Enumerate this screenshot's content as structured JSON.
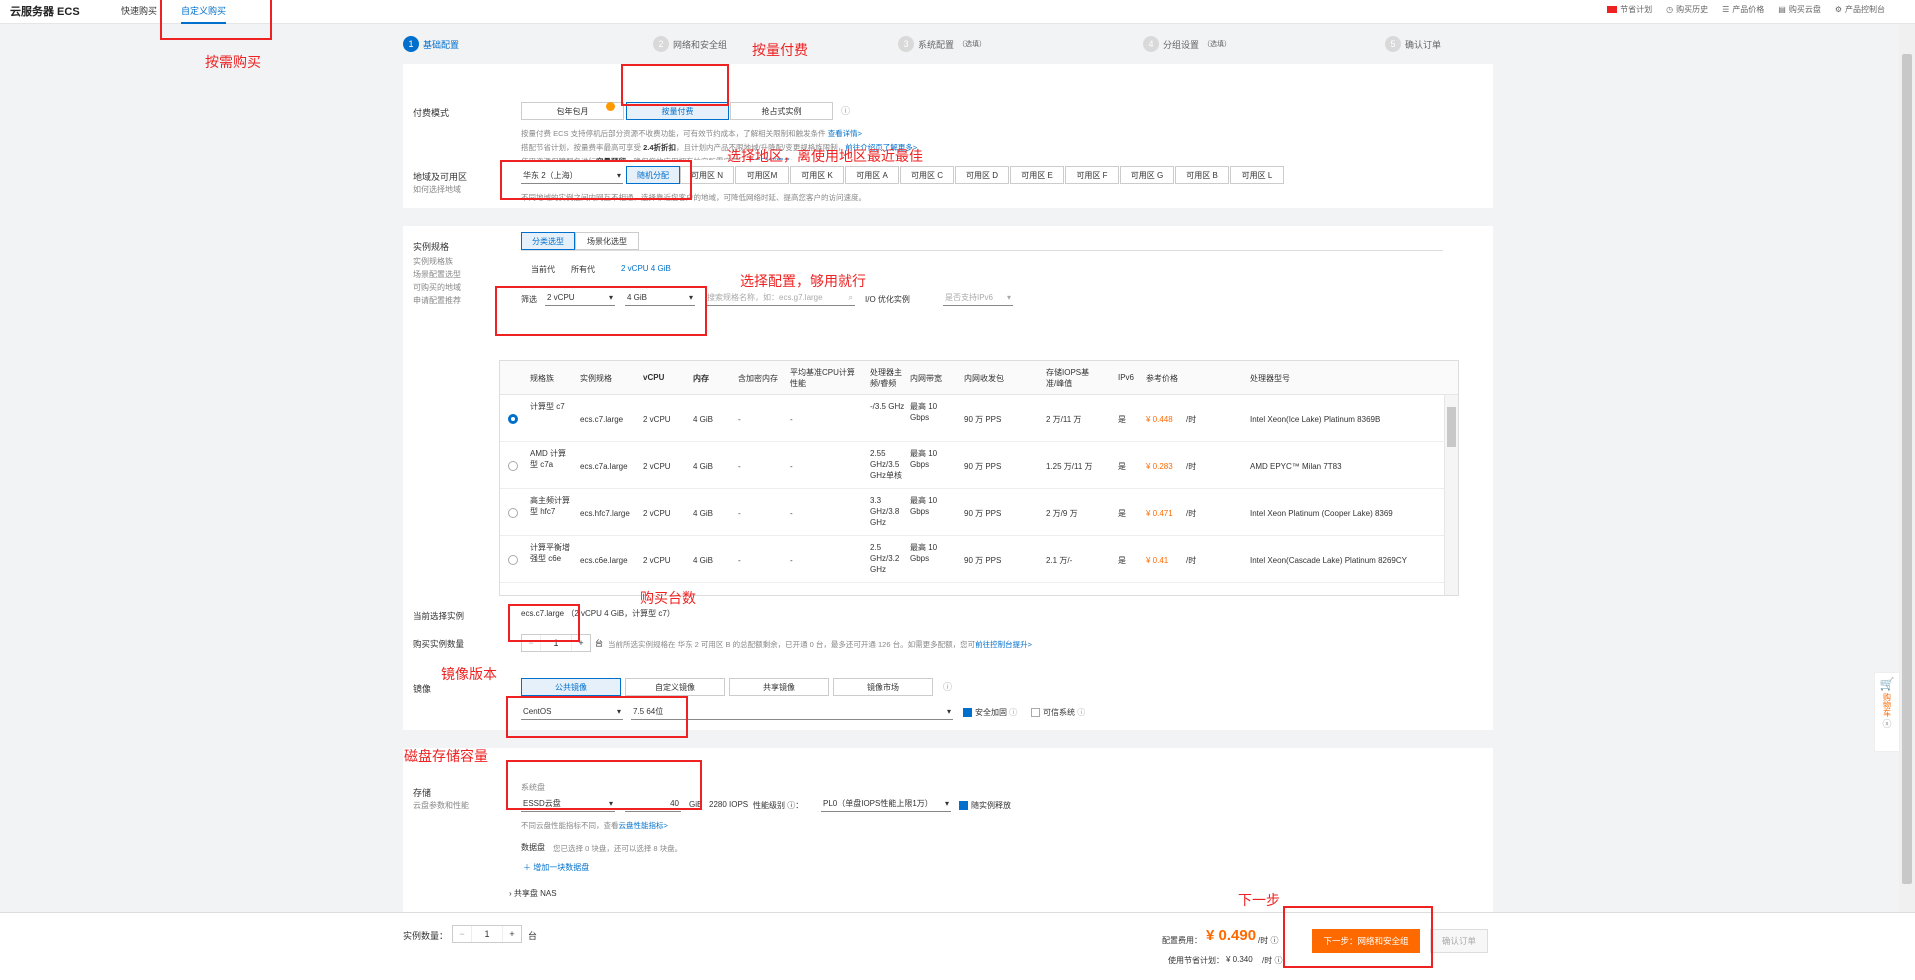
{
  "topbar": {
    "brand": "云服务器 ECS",
    "tabs": [
      "快速购买",
      "自定义购买"
    ],
    "links": [
      "节省计划",
      "购买历史",
      "产品价格",
      "购买云盘",
      "产品控制台"
    ]
  },
  "steps": [
    {
      "num": "1",
      "label": "基础配置",
      "opt": ""
    },
    {
      "num": "2",
      "label": "网络和安全组",
      "opt": ""
    },
    {
      "num": "3",
      "label": "系统配置",
      "opt": "（选填）"
    },
    {
      "num": "4",
      "label": "分组设置",
      "opt": "（选填）"
    },
    {
      "num": "5",
      "label": "确认订单",
      "opt": ""
    }
  ],
  "billing": {
    "label": "付费模式",
    "options": [
      "包年包月",
      "按量付费",
      "抢占式实例"
    ],
    "notes": [
      "按量付费 ECS 支持停机后部分资源不收费功能，可有效节约成本，了解相关限制和触发条件",
      "查看详情>",
      "搭配节省计划，按量费率最高可享受",
      "2.4折折扣",
      "，且计划内产品不限地域/升降配/变更规格族限制，",
      "前往介绍页了解更多>",
      "使用资源保障服务进行",
      "容量预留",
      "，确保您的应用拥有扩容所需容量，",
      "点击了解更多>"
    ]
  },
  "region": {
    "label": "地域及可用区",
    "help": "如何选择地域",
    "selected": "华东 2（上海）",
    "zones": [
      "随机分配",
      "可用区 N",
      "可用区M",
      "可用区 K",
      "可用区 A",
      "可用区 C",
      "可用区 D",
      "可用区 E",
      "可用区 F",
      "可用区 G",
      "可用区 B",
      "可用区 L"
    ],
    "note": "不同地域的实例之间内网互不相通，选择靠近您客户的地域，可降低网络时延、提高您客户的访问速度。"
  },
  "instance": {
    "label": "实例规格",
    "side_links": [
      "实例规格族",
      "场景配置选型",
      "可购买的地域",
      "申请配置推荐"
    ],
    "tabs": [
      "分类选型",
      "场景化选型"
    ],
    "gens": [
      "当前代",
      "所有代",
      "2 vCPU 4 GiB"
    ],
    "filter_label": "筛选",
    "cpu": "2 vCPU",
    "mem": "4 GiB",
    "search_placeholder": "搜索规格名称，如：ecs.g7.large",
    "io_label": "I/O 优化实例",
    "ipv6": "是否支持IPv6",
    "headers": [
      "规格族",
      "实例规格",
      "vCPU",
      "内存",
      "含加密内存",
      "平均基准CPU计算性能",
      "处理器主频/睿频",
      "内网带宽",
      "内网收发包",
      "存储IOPS基准/峰值",
      "IPv6",
      "参考价格",
      "处理器型号"
    ],
    "rows": [
      {
        "family": "计算型 c7",
        "spec": "ecs.c7.large",
        "vcpu": "2 vCPU",
        "mem": "4 GiB",
        "enc": "-",
        "base": "-",
        "freq": "-/3.5 GHz",
        "bw": "最高 10 Gbps",
        "pps": "90 万 PPS",
        "iops": "2 万/11 万",
        "ipv6": "是",
        "price": "¥ 0.448",
        "unit": "/时",
        "cpu_model": "Intel Xeon(Ice Lake) Platinum 8369B"
      },
      {
        "family": "AMD 计算型 c7a",
        "spec": "ecs.c7a.large",
        "vcpu": "2 vCPU",
        "mem": "4 GiB",
        "enc": "-",
        "base": "-",
        "freq": "2.55 GHz/3.5 GHz单核",
        "bw": "最高 10 Gbps",
        "pps": "90 万 PPS",
        "iops": "1.25 万/11 万",
        "ipv6": "是",
        "price": "¥ 0.283",
        "unit": "/时",
        "cpu_model": "AMD EPYC™ Milan 7T83"
      },
      {
        "family": "高主频计算型 hfc7",
        "spec": "ecs.hfc7.large",
        "vcpu": "2 vCPU",
        "mem": "4 GiB",
        "enc": "-",
        "base": "-",
        "freq": "3.3 GHz/3.8 GHz",
        "bw": "最高 10 Gbps",
        "pps": "90 万 PPS",
        "iops": "2 万/9 万",
        "ipv6": "是",
        "price": "¥ 0.471",
        "unit": "/时",
        "cpu_model": "Intel Xeon Platinum (Cooper Lake) 8369"
      },
      {
        "family": "计算平衡增强型 c6e",
        "spec": "ecs.c6e.large",
        "vcpu": "2 vCPU",
        "mem": "4 GiB",
        "enc": "-",
        "base": "-",
        "freq": "2.5 GHz/3.2 GHz",
        "bw": "最高 10 Gbps",
        "pps": "90 万 PPS",
        "iops": "2.1 万/-",
        "ipv6": "是",
        "price": "¥ 0.41",
        "unit": "/时",
        "cpu_model": "Intel Xeon(Cascade Lake) Platinum 8269CY"
      }
    ]
  },
  "current": {
    "label": "当前选择实例",
    "value": "ecs.c7.large （2 vCPU 4 GiB，计算型 c7）"
  },
  "quantity": {
    "label": "购买实例数量",
    "value": "1",
    "unit": "台",
    "note": "当前所选实例规格在 华东 2 可用区 B 的总配额剩余，已开通 0 台，最多还可开通 126 台。如需更多配额，您可",
    "link": "前往控制台提升>"
  },
  "image": {
    "label": "镜像",
    "tabs": [
      "公共镜像",
      "自定义镜像",
      "共享镜像",
      "镜像市场"
    ],
    "os": "CentOS",
    "version": "7.5 64位",
    "secure": "安全加固",
    "trusted": "可信系统"
  },
  "storage": {
    "label": "存储",
    "sub": "云盘参数和性能",
    "sys_label": "系统盘",
    "disk_type": "ESSD云盘",
    "size": "40",
    "unit": "GiB",
    "iops": "2280 IOPS",
    "perf_label": "性能级别",
    "perf": "PL0（单盘IOPS性能上限1万）",
    "release": "随实例释放",
    "hint": "不同云盘性能指标不同，查看",
    "hint_link": "云盘性能指标>",
    "data_label": "数据盘",
    "data_note": "您已选择 0 块盘，还可以选择 8 块盘。",
    "add_data": "增加一块数据盘",
    "nas": "共享盘 NAS"
  },
  "footer": {
    "qty_label": "实例数量：",
    "qty": "1",
    "qty_unit": "台",
    "fee_label": "配置费用：",
    "fee": "¥ 0.490",
    "fee_unit": "/时",
    "plan_label": "使用节省计划：",
    "plan": "¥ 0.340",
    "plan_unit": "/时",
    "next": "下一步：网络和安全组",
    "confirm": "确认订单"
  },
  "cart": {
    "label": "购物车"
  },
  "annotations": {
    "a1": "按需购买",
    "a2": "按量付费",
    "a3": "选择地区，离使用地区最近最佳",
    "a4": "选择配置，够用就行",
    "a5": "购买台数",
    "a6": "镜像版本",
    "a7": "磁盘存储容量",
    "a8": "下一步"
  }
}
